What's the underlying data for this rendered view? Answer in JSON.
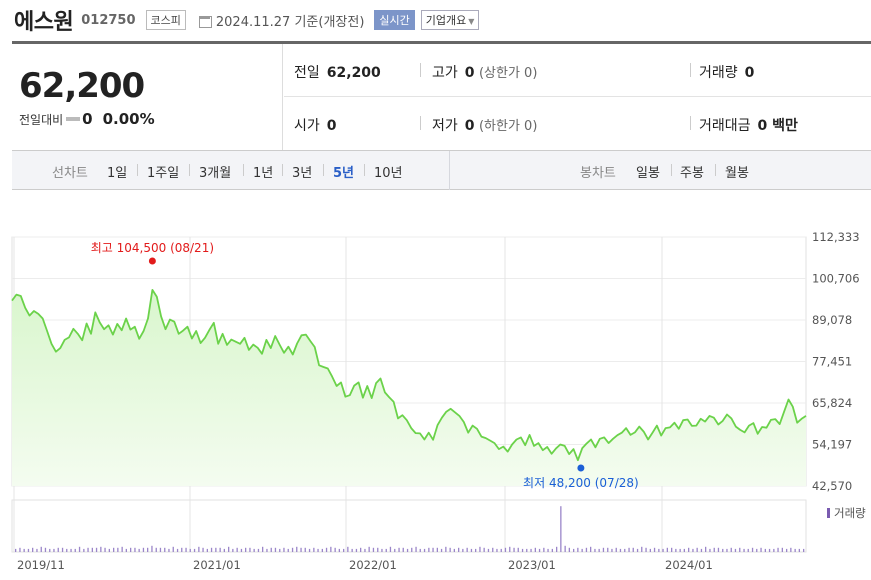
{
  "stock": {
    "name": "에스원",
    "code": "012750",
    "market": "코스피",
    "date": "2024.11.27 기준(개장전)",
    "realtime_label": "실시간",
    "info_label": "기업개요"
  },
  "summary": {
    "price": "62,200",
    "change_label": "전일대비",
    "change": "0",
    "change_pct": "0.00%",
    "prev_close_label": "전일",
    "prev_close": "62,200",
    "high_label": "고가",
    "high": "0",
    "upper_limit": "(상한가 0)",
    "volume_label": "거래량",
    "volume": "0",
    "open_label": "시가",
    "open": "0",
    "low_label": "저가",
    "low": "0",
    "lower_limit": "(하한가 0)",
    "amount_label": "거래대금",
    "amount": "0 백만"
  },
  "tabs": {
    "line_label": "선차트",
    "line_items": [
      "1일",
      "1주일",
      "3개월",
      "1년",
      "3년",
      "5년",
      "10년"
    ],
    "active": "5년",
    "candle_label": "봉차트",
    "candle_items": [
      "일봉",
      "주봉",
      "월봉"
    ]
  },
  "colors": {
    "line": "#6bd24a",
    "fill_top": "#d9f6cd",
    "high": "#e21b1b",
    "low": "#1b5fd6",
    "accent": "#2a5fc7"
  },
  "chart_data": {
    "type": "area",
    "x_ticks": [
      "2019/11",
      "2021/01",
      "2022/01",
      "2023/01",
      "2024/01"
    ],
    "y_ticks": [
      "112,333",
      "100,706",
      "89,078",
      "77,451",
      "65,824",
      "54,197",
      "42,570"
    ],
    "ylim": [
      42570,
      112333
    ],
    "high_label": "최고 104,500 (08/21)",
    "low_label": "최저 48,200 (07/28)",
    "volume_label": "거래량",
    "series": [
      {
        "values": [
          94500,
          96200,
          95800,
          92500,
          90300,
          91600,
          90800,
          89500,
          86000,
          82400,
          80200,
          81200,
          83500,
          84200,
          86600,
          85200,
          83400,
          88100,
          85200,
          91200,
          88400,
          86500,
          87600,
          85000,
          88000,
          86200,
          89500,
          86400,
          87200,
          83800,
          86000,
          89500,
          97500,
          95600,
          90100,
          86500,
          89200,
          88600,
          85200,
          86100,
          87200,
          83900,
          86000,
          82600,
          84100,
          86300,
          88300,
          82400,
          85200,
          82100,
          83600,
          83000,
          82400,
          84100,
          80700,
          82200,
          81300,
          79600,
          83500,
          81200,
          84600,
          82200,
          79900,
          81600,
          79400,
          82500,
          84800,
          85000,
          83200,
          81500,
          76400,
          75900,
          75500,
          73200,
          70600,
          71600,
          67600,
          68000,
          70700,
          71600,
          67300,
          70600,
          67200,
          71400,
          72700,
          68800,
          67400,
          66200,
          61500,
          62400,
          61000,
          58800,
          57400,
          57300,
          55600,
          57500,
          55500,
          59600,
          61700,
          63400,
          64200,
          63200,
          62200,
          60500,
          57500,
          59500,
          58600,
          56400,
          56000,
          55300,
          54600,
          52900,
          53600,
          52200,
          54200,
          55600,
          56200,
          54000,
          56900,
          53800,
          54600,
          52600,
          53500,
          51600,
          53100,
          54200,
          53800,
          51500,
          52900,
          49800,
          53200,
          54500,
          55600,
          53400,
          55800,
          56200,
          54600,
          55800,
          56800,
          57500,
          58800,
          56900,
          57600,
          59200,
          57800,
          55600,
          57500,
          59500,
          56700,
          58800,
          59000,
          60300,
          58600,
          61000,
          61200,
          59400,
          59500,
          61400,
          60600,
          62200,
          61700,
          59800,
          60800,
          62600,
          61500,
          59200,
          58300,
          57600,
          59500,
          60200,
          57200,
          59100,
          58900,
          61100,
          61300,
          59900,
          63400,
          66800,
          64800,
          60300,
          61400,
          62200
        ]
      }
    ],
    "volume": [
      3,
      4,
      3,
      3,
      4,
      3,
      5,
      4,
      3,
      3,
      4,
      4,
      3,
      3,
      3,
      5,
      3,
      4,
      4,
      4,
      5,
      4,
      3,
      4,
      4,
      5,
      3,
      4,
      4,
      3,
      4,
      4,
      6,
      4,
      4,
      4,
      3,
      5,
      3,
      4,
      4,
      3,
      3,
      5,
      4,
      3,
      4,
      4,
      4,
      3,
      5,
      3,
      4,
      3,
      4,
      4,
      3,
      3,
      5,
      3,
      4,
      4,
      3,
      4,
      3,
      4,
      5,
      4,
      4,
      3,
      4,
      3,
      3,
      4,
      5,
      4,
      3,
      3,
      5,
      3,
      3,
      4,
      3,
      5,
      4,
      4,
      3,
      3,
      5,
      3,
      4,
      4,
      3,
      4,
      5,
      3,
      3,
      4,
      4,
      4,
      3,
      5,
      4,
      3,
      4,
      3,
      4,
      3,
      3,
      5,
      4,
      3,
      4,
      3,
      3,
      4,
      5,
      4,
      4,
      3,
      3,
      3,
      4,
      3,
      4,
      3,
      3,
      5,
      44,
      6,
      4,
      3,
      4,
      3,
      4,
      5,
      3,
      3,
      4,
      4,
      3,
      4,
      3,
      3,
      4,
      4,
      3,
      5,
      4,
      3,
      4,
      3,
      3,
      4,
      4,
      3,
      3,
      3,
      4,
      3,
      4,
      3,
      5,
      3,
      4,
      4,
      3,
      3,
      4,
      3,
      4,
      3,
      3,
      4,
      3,
      4,
      3,
      3,
      3,
      4,
      4,
      3,
      4,
      3,
      3,
      3
    ]
  }
}
